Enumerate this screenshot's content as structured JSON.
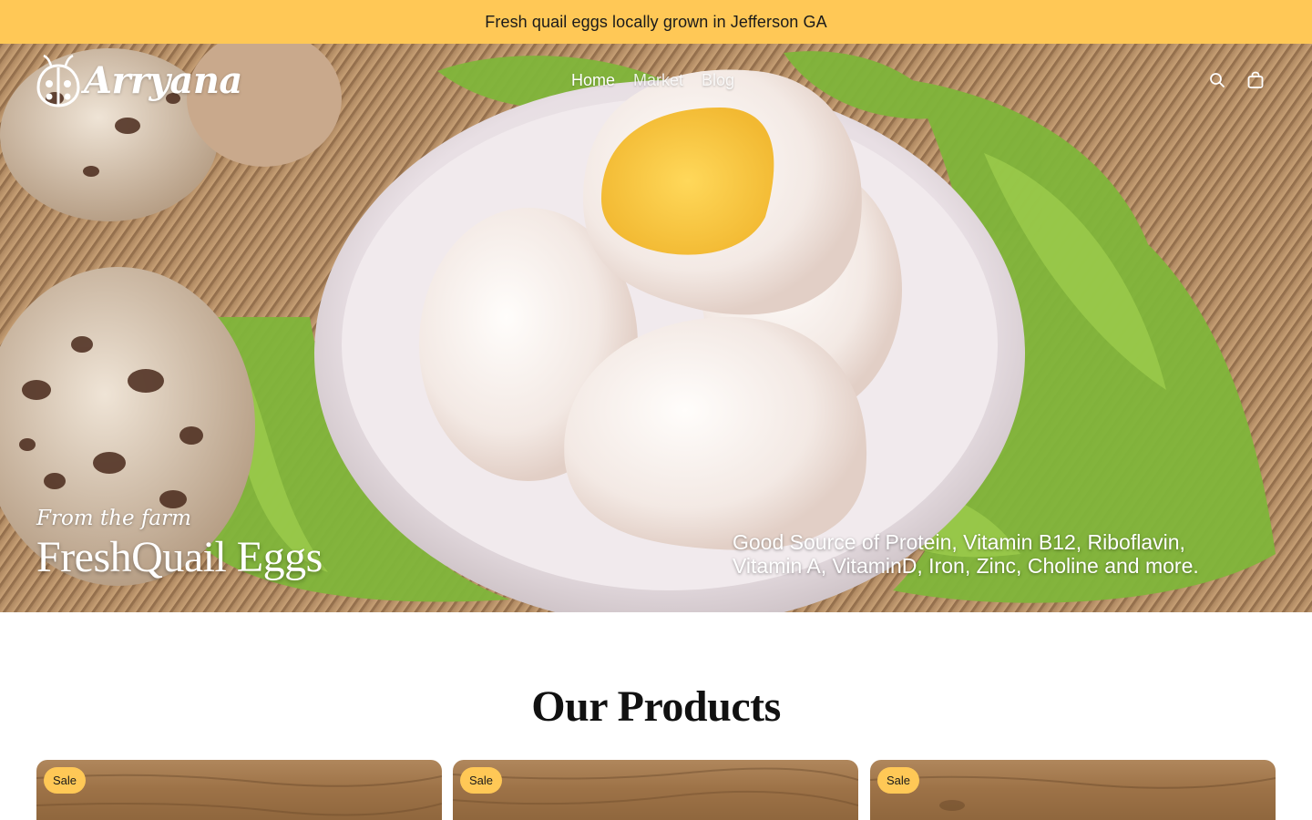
{
  "announcement": {
    "text": "Fresh quail eggs locally grown in Jefferson GA"
  },
  "header": {
    "brand": "Arryana",
    "nav": [
      {
        "label": "Home",
        "active": true
      },
      {
        "label": "Market",
        "active": false
      },
      {
        "label": "Blog",
        "active": false
      }
    ],
    "icons": [
      "search-icon",
      "cart-icon"
    ]
  },
  "hero": {
    "kicker": "From the farm",
    "title": "FreshQuail Eggs",
    "description": "Good Source of Protein, Vitamin B12, Riboflavin, Vitamin A, VitaminD, Iron, Zinc, Choline and more."
  },
  "products": {
    "title": "Our Products",
    "cards": [
      {
        "badge": "Sale"
      },
      {
        "badge": "Sale"
      },
      {
        "badge": "Sale"
      }
    ]
  },
  "colors": {
    "accent": "#ffc856",
    "text": "#111111"
  }
}
